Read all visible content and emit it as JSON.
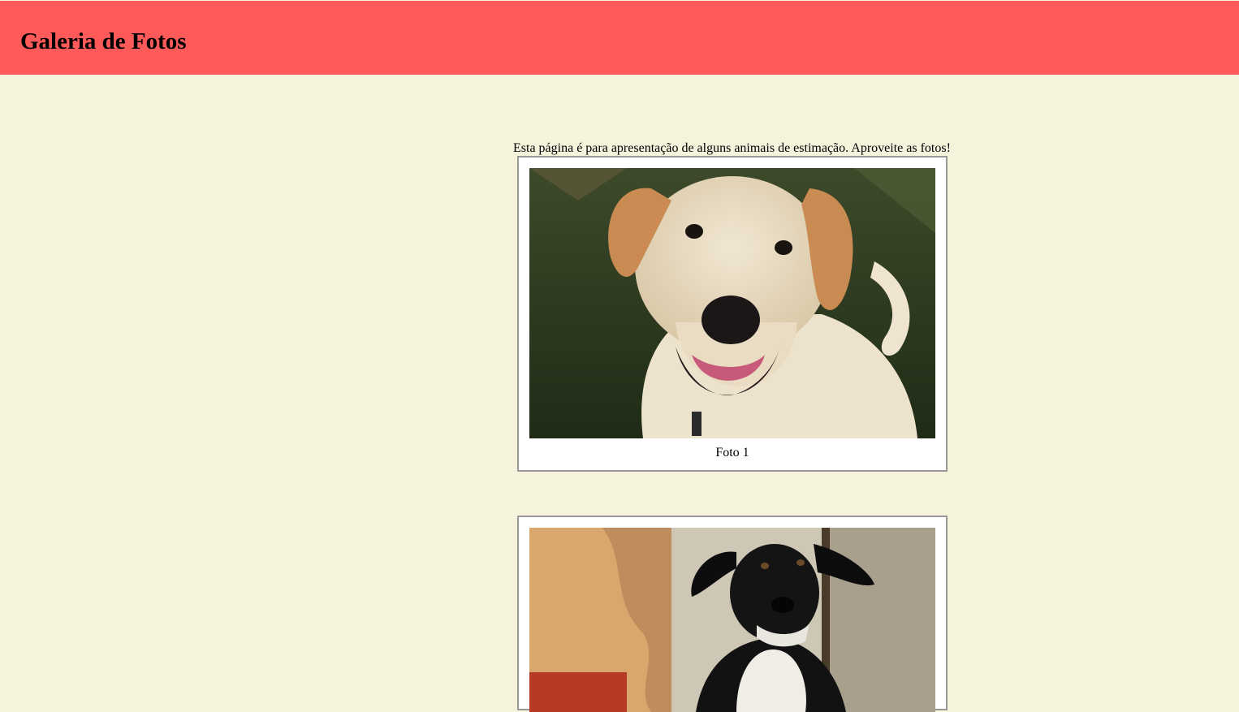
{
  "header": {
    "title": "Galeria de Fotos"
  },
  "intro": {
    "text": "Esta página é para apresentação de alguns animais de estimação. Aproveite as fotos!"
  },
  "photos": [
    {
      "caption": "Foto 1",
      "subject": "light-tan-dog-on-grass"
    },
    {
      "caption": "",
      "subject": "black-and-white-dog-by-rusty-wall"
    }
  ],
  "colors": {
    "header_bg": "#ff5a5a",
    "page_bg": "#f5f3dc",
    "card_bg": "#ffffff",
    "card_border": "#999999"
  }
}
